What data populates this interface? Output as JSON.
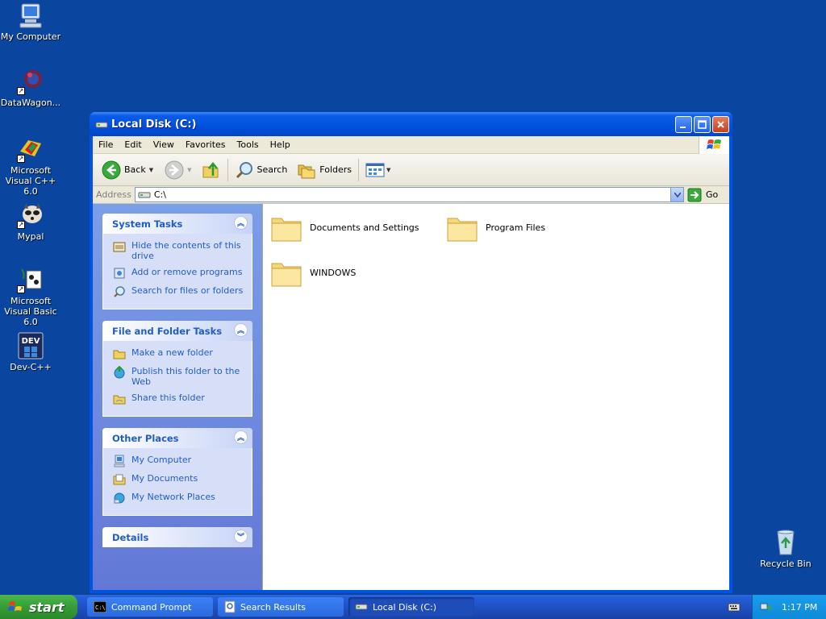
{
  "desktop": {
    "icons": [
      {
        "label": "My Computer",
        "icon": "my-computer-icon"
      },
      {
        "label": "DataWagon...",
        "icon": "datawagon-icon"
      },
      {
        "label": "Microsoft Visual C++ 6.0",
        "icon": "visual-cpp-icon"
      },
      {
        "label": "Mypal",
        "icon": "mypal-icon"
      },
      {
        "label": "Microsoft Visual Basic 6.0",
        "icon": "visual-basic-icon"
      },
      {
        "label": "Dev-C++",
        "icon": "dev-cpp-icon"
      },
      {
        "label": "Recycle Bin",
        "icon": "recycle-bin-icon"
      }
    ],
    "background": "#0a46a0"
  },
  "window": {
    "title": "Local Disk (C:)",
    "menu": [
      "File",
      "Edit",
      "View",
      "Favorites",
      "Tools",
      "Help"
    ],
    "toolbar": {
      "back_label": "Back",
      "search_label": "Search",
      "folders_label": "Folders"
    },
    "address": {
      "label": "Address",
      "value": "C:\\",
      "go_label": "Go"
    },
    "taskpane": {
      "groups": [
        {
          "title": "System Tasks",
          "links": [
            "Hide the contents of this drive",
            "Add or remove programs",
            "Search for files or folders"
          ]
        },
        {
          "title": "File and Folder Tasks",
          "links": [
            "Make a new folder",
            "Publish this folder to the Web",
            "Share this folder"
          ]
        },
        {
          "title": "Other Places",
          "links": [
            "My Computer",
            "My Documents",
            "My Network Places"
          ]
        },
        {
          "title": "Details",
          "links": []
        }
      ]
    },
    "files": [
      {
        "name": "Documents and Settings"
      },
      {
        "name": "Program Files"
      },
      {
        "name": "WINDOWS"
      }
    ]
  },
  "taskbar": {
    "start_label": "start",
    "tasks": [
      {
        "label": "Command Prompt"
      },
      {
        "label": "Search Results"
      },
      {
        "label": "Local Disk (C:)"
      }
    ],
    "clock": "1:17 PM"
  }
}
